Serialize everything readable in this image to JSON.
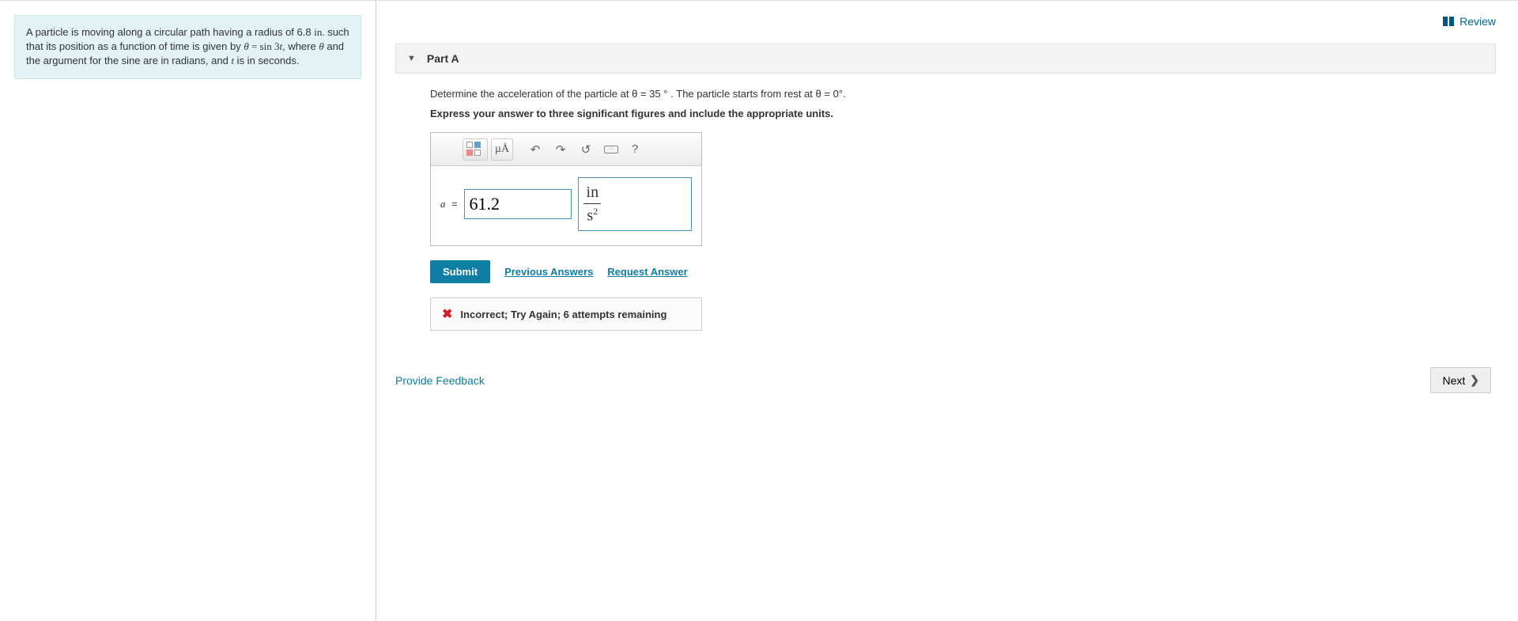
{
  "review": {
    "label": "Review"
  },
  "problem": {
    "line1a": "A particle is moving along a circular path having a radius of 6.8 ",
    "line1b": "in.",
    "line2a": " such that its position as a function of time is given by ",
    "theta": "θ",
    "eq": " = ",
    "sinexpr_a": "sin",
    "sinexpr_b": " 3",
    "sinexpr_c": "t",
    "line2c": ", where ",
    "line2d": " and the argument for the sine are in radians, and ",
    "line2e": " is in seconds."
  },
  "part": {
    "title": "Part A",
    "instruction_a": "Determine the acceleration of the particle at ",
    "instruction_b": " = 35 ° . The particle starts from rest at ",
    "instruction_c": " = 0°.",
    "express": "Express your answer to three significant figures and include the appropriate units.",
    "var": "a",
    "equals": "=",
    "value": "61.2",
    "unit_num": "in",
    "unit_den_base": "s",
    "unit_den_exp": "2"
  },
  "toolbar": {
    "units_label": "µÅ",
    "help": "?"
  },
  "actions": {
    "submit": "Submit",
    "previous": "Previous Answers",
    "request": "Request Answer"
  },
  "feedback": {
    "text": "Incorrect; Try Again; 6 attempts remaining"
  },
  "bottom": {
    "provide": "Provide Feedback",
    "next": "Next"
  }
}
